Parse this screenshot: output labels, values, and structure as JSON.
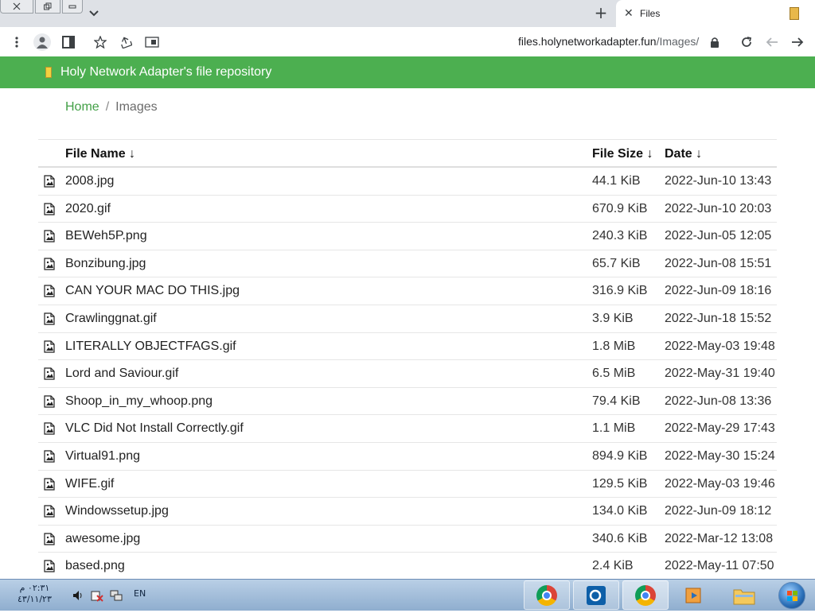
{
  "browser": {
    "tab_title": "Files",
    "new_tab_symbol": "+",
    "url_host": "files.holynetworkadapter.fun",
    "url_path": "/Images/"
  },
  "header": {
    "title": "Holy Network Adapter's file repository"
  },
  "breadcrumb": {
    "home": "Home",
    "separator": "/",
    "current": "Images"
  },
  "table": {
    "headers": {
      "name": "File Name  ↓",
      "size": "File Size  ↓",
      "date": "Date  ↓"
    },
    "rows": [
      {
        "name": "2008.jpg",
        "size": "44.1 KiB",
        "date": "2022-Jun-10 13:43"
      },
      {
        "name": "2020.gif",
        "size": "670.9 KiB",
        "date": "2022-Jun-10 20:03"
      },
      {
        "name": "BEWeh5P.png",
        "size": "240.3 KiB",
        "date": "2022-Jun-05 12:05"
      },
      {
        "name": "Bonzibung.jpg",
        "size": "65.7 KiB",
        "date": "2022-Jun-08 15:51"
      },
      {
        "name": "CAN YOUR MAC DO THIS.jpg",
        "size": "316.9 KiB",
        "date": "2022-Jun-09 18:16"
      },
      {
        "name": "Crawlinggnat.gif",
        "size": "3.9 KiB",
        "date": "2022-Jun-18 15:52"
      },
      {
        "name": "LITERALLY OBJECTFAGS.gif",
        "size": "1.8 MiB",
        "date": "2022-May-03 19:48"
      },
      {
        "name": "Lord and Saviour.gif",
        "size": "6.5 MiB",
        "date": "2022-May-31 19:40"
      },
      {
        "name": "Shoop_in_my_whoop.png",
        "size": "79.4 KiB",
        "date": "2022-Jun-08 13:36"
      },
      {
        "name": "VLC Did Not Install Correctly.gif",
        "size": "1.1 MiB",
        "date": "2022-May-29 17:43"
      },
      {
        "name": "Virtual91.png",
        "size": "894.9 KiB",
        "date": "2022-May-30 15:24"
      },
      {
        "name": "WIFE.gif",
        "size": "129.5 KiB",
        "date": "2022-May-03 19:46"
      },
      {
        "name": "Windowssetup.jpg",
        "size": "134.0 KiB",
        "date": "2022-Jun-09 18:12"
      },
      {
        "name": "awesome.jpg",
        "size": "340.6 KiB",
        "date": "2022-Mar-12 13:08"
      },
      {
        "name": "based.png",
        "size": "2.4 KiB",
        "date": "2022-May-11 07:50"
      }
    ]
  },
  "taskbar": {
    "time": "٠٢:٣١ م",
    "date": "٤٣/١١/٢٣",
    "language": "EN"
  },
  "colors": {
    "header_green": "#4caf50",
    "link_green": "#43a047",
    "taskbar_blue": "#8faecf"
  },
  "icons": [
    "close-icon",
    "restore-icon",
    "minimize-icon",
    "chevron-down-icon",
    "plus-icon",
    "menu-dots-icon",
    "profile-icon",
    "sidebar-icon",
    "star-icon",
    "share-icon",
    "cast-icon",
    "lock-icon",
    "reload-icon",
    "back-icon",
    "forward-icon",
    "image-file-icon"
  ]
}
